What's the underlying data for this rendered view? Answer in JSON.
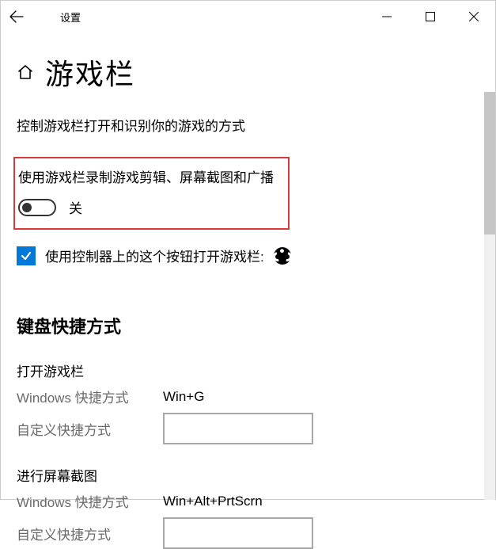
{
  "titlebar": {
    "title": "设置"
  },
  "page": {
    "title": "游戏栏",
    "description": "控制游戏栏打开和识别你的游戏的方式"
  },
  "gamebar_toggle": {
    "label": "使用游戏栏录制游戏剪辑、屏幕截图和广播",
    "state": "关"
  },
  "controller_checkbox": {
    "label": "使用控制器上的这个按钮打开游戏栏:",
    "checked": true
  },
  "shortcuts": {
    "section_title": "键盘快捷方式",
    "open_gamebar": {
      "title": "打开游戏栏",
      "windows_label": "Windows 快捷方式",
      "windows_value": "Win+G",
      "custom_label": "自定义快捷方式",
      "custom_value": ""
    },
    "screenshot": {
      "title": "进行屏幕截图",
      "windows_label": "Windows 快捷方式",
      "windows_value": "Win+Alt+PrtScrn",
      "custom_label": "自定义快捷方式",
      "custom_value": ""
    }
  }
}
